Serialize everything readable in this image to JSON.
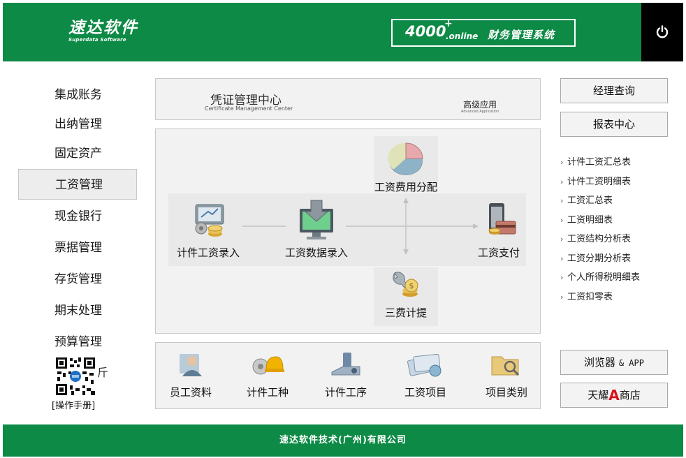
{
  "header": {
    "logo_cn": "速达软件",
    "logo_en": "Superdata Software",
    "brand_num": "4000",
    "brand_plus": "+",
    "brand_online": ".online",
    "brand_title": "财务管理系统",
    "bg_color": "#0d8a45"
  },
  "nav": {
    "items": [
      {
        "label": "集成账务"
      },
      {
        "label": "出纳管理"
      },
      {
        "label": "固定资产"
      },
      {
        "label": "工资管理",
        "active": true
      },
      {
        "label": "现金银行"
      },
      {
        "label": "票据管理"
      },
      {
        "label": "存货管理"
      },
      {
        "label": "期末处理"
      },
      {
        "label": "预算管理"
      }
    ],
    "qr_side_text": "斤",
    "manual_label": "操作手册"
  },
  "cert_panel": {
    "title": "凭证管理中心",
    "subtitle": "Certificate Management Center",
    "adv_title": "高级应用",
    "adv_subtitle": "Advanced Application"
  },
  "flow": {
    "piece_wage_entry": "计件工资录入",
    "wage_data_entry": "工资数据录入",
    "wage_payment": "工资支付",
    "cost_allocation": "工资费用分配",
    "three_fees": "三费计提"
  },
  "bottom_bar": {
    "items": [
      {
        "label": "员工资料",
        "icon": "employee-icon"
      },
      {
        "label": "计件工种",
        "icon": "worker-type-icon"
      },
      {
        "label": "计件工序",
        "icon": "process-icon"
      },
      {
        "label": "工资项目",
        "icon": "wage-item-icon"
      },
      {
        "label": "项目类别",
        "icon": "category-icon"
      }
    ]
  },
  "right": {
    "manager_query": "经理查询",
    "report_center": "报表中心",
    "reports": [
      "计件工资汇总表",
      "计件工资明细表",
      "工资汇总表",
      "工资明细表",
      "工资结构分析表",
      "工资分期分析表",
      "个人所得税明细表",
      "工资扣零表"
    ],
    "browser_label": "浏览器",
    "browser_app": "& APP",
    "store_prefix": "天耀",
    "store_mark": "A",
    "store_suffix": "商店"
  },
  "footer": {
    "company": "速达软件技术(广州)有限公司"
  }
}
